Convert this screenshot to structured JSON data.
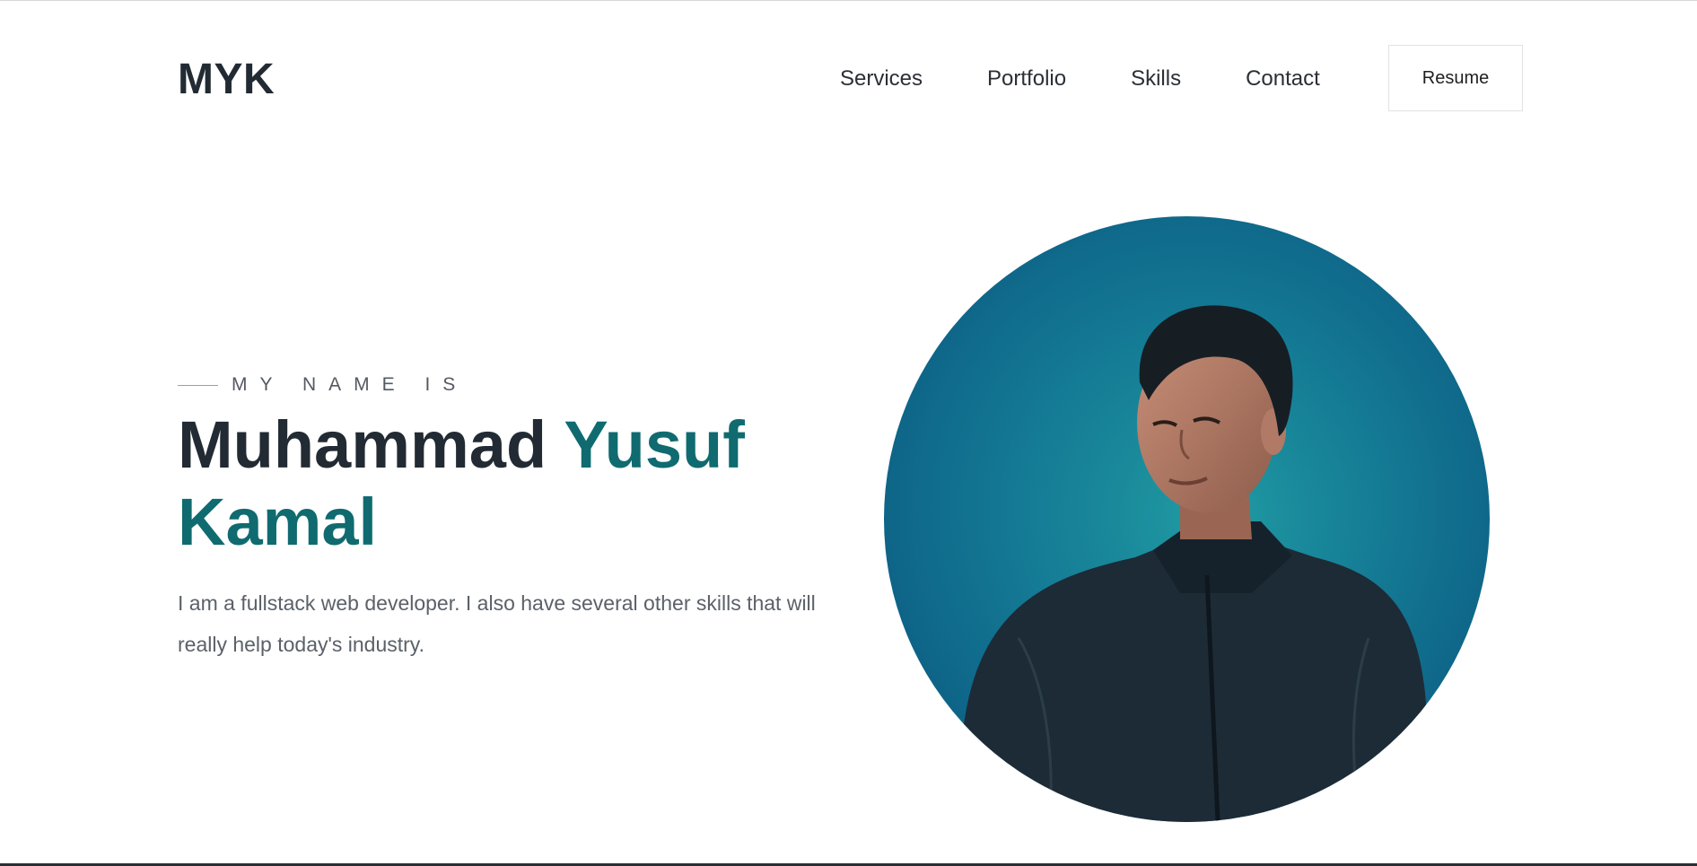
{
  "header": {
    "logo": "MYK",
    "nav": [
      {
        "label": "Services"
      },
      {
        "label": "Portfolio"
      },
      {
        "label": "Skills"
      },
      {
        "label": "Contact"
      }
    ],
    "resume_label": "Resume"
  },
  "hero": {
    "eyebrow": "MY NAME IS",
    "name_first": "Muhammad",
    "name_accent": "Yusuf Kamal",
    "description": "I am a fullstack web developer. I also have several other skills that will really help today's industry."
  },
  "colors": {
    "text_dark": "#222a33",
    "accent": "#0f6b70",
    "muted": "#5b6169",
    "portrait_bg": "#15809a"
  }
}
